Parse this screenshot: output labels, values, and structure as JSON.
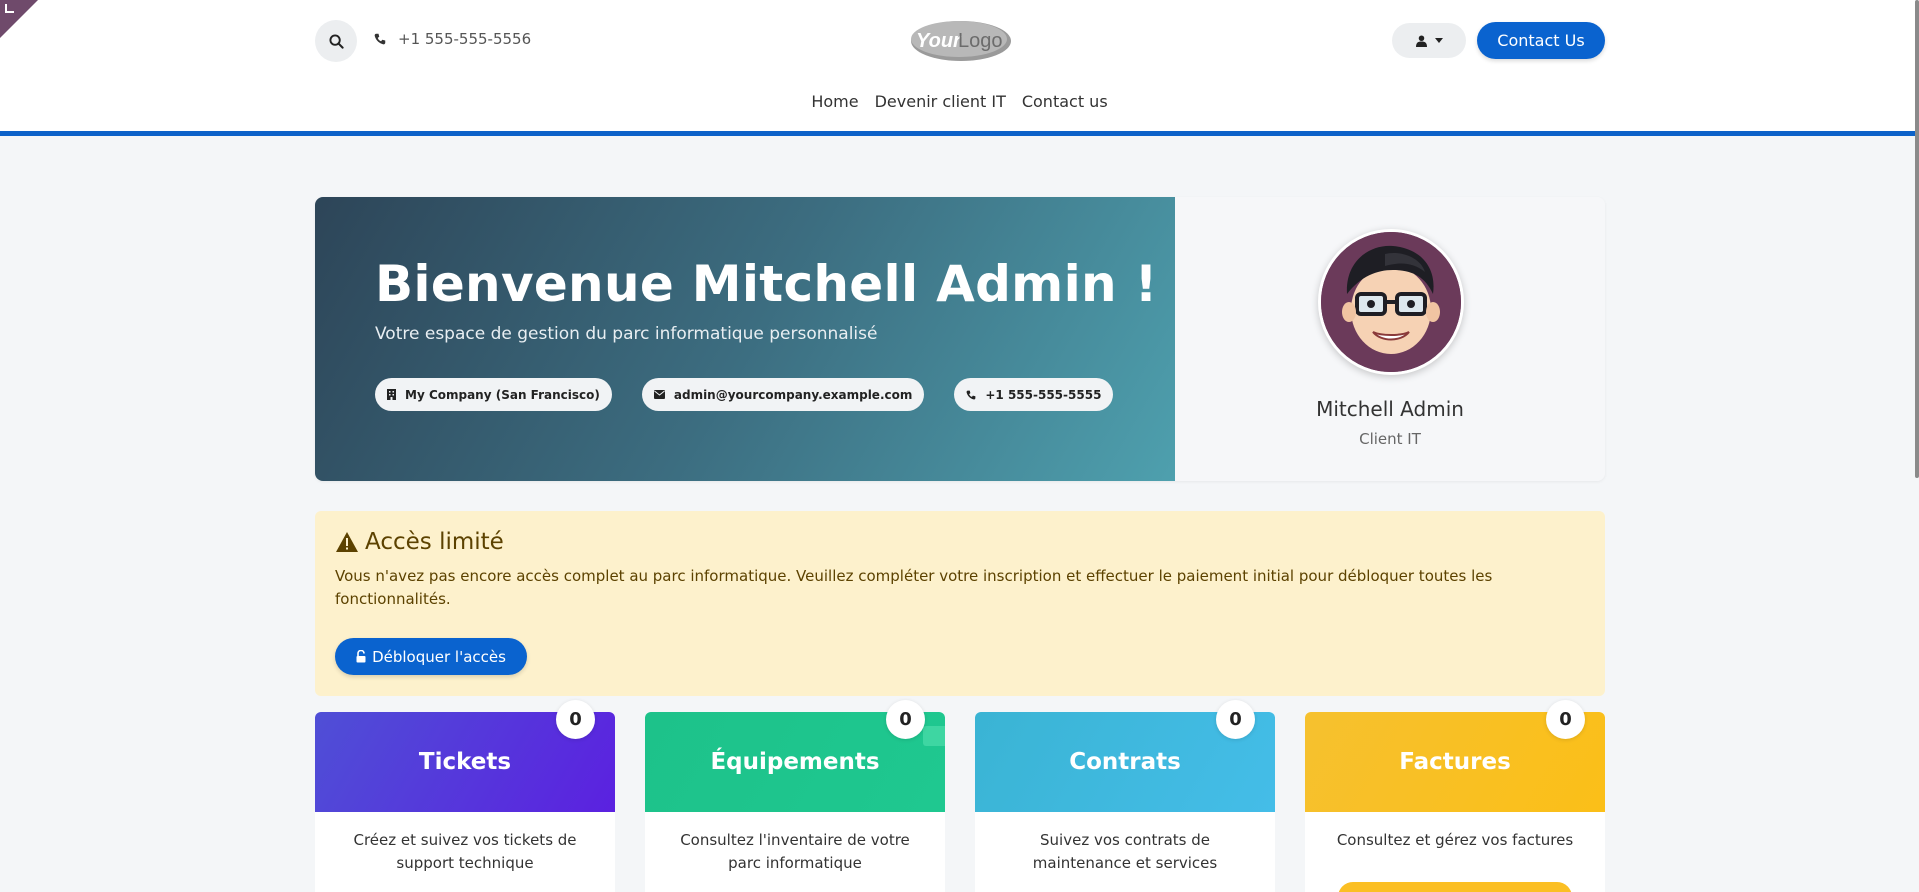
{
  "header": {
    "phone": "+1 555-555-5556",
    "logo_text_bold": "Your",
    "logo_text_light": "Logo",
    "contact_button": "Contact Us",
    "nav": [
      "Home",
      "Devenir client IT",
      "Contact us"
    ],
    "accent_color": "#0d62c9"
  },
  "hero": {
    "title": "Bienvenue Mitchell Admin !",
    "subtitle": "Votre espace de gestion du parc informatique personnalisé",
    "chips": [
      {
        "icon": "building-icon",
        "text": "My Company (San Francisco)"
      },
      {
        "icon": "envelope-icon",
        "text": "admin@yourcompany.example.com"
      },
      {
        "icon": "phone-icon",
        "text": "+1 555-555-5555"
      }
    ],
    "profile_name": "Mitchell Admin",
    "profile_role": "Client IT"
  },
  "alert": {
    "title": "Accès limité",
    "text": "Vous n'avez pas encore accès complet au parc informatique. Veuillez compléter votre inscription et effectuer le paiement initial pour débloquer toutes les fonctionnalités.",
    "button": "Débloquer l'accès"
  },
  "cards": [
    {
      "title": "Tickets",
      "count": "0",
      "desc": "Créez et suivez vos tickets de support technique",
      "color_from": "#4f4fd6",
      "color_to": "#5b21e0"
    },
    {
      "title": "Équipements",
      "count": "0",
      "desc": "Consultez l'inventaire de votre parc informatique",
      "color_from": "#1dc28a",
      "color_to": "#1fc890"
    },
    {
      "title": "Contrats",
      "count": "0",
      "desc": "Suivez vos contrats de maintenance et services",
      "color_from": "#3ab4d4",
      "color_to": "#44bde8"
    },
    {
      "title": "Factures",
      "count": "0",
      "desc": "Consultez et gérez vos factures",
      "color_from": "#f6c12f",
      "color_to": "#fbbf18"
    }
  ]
}
